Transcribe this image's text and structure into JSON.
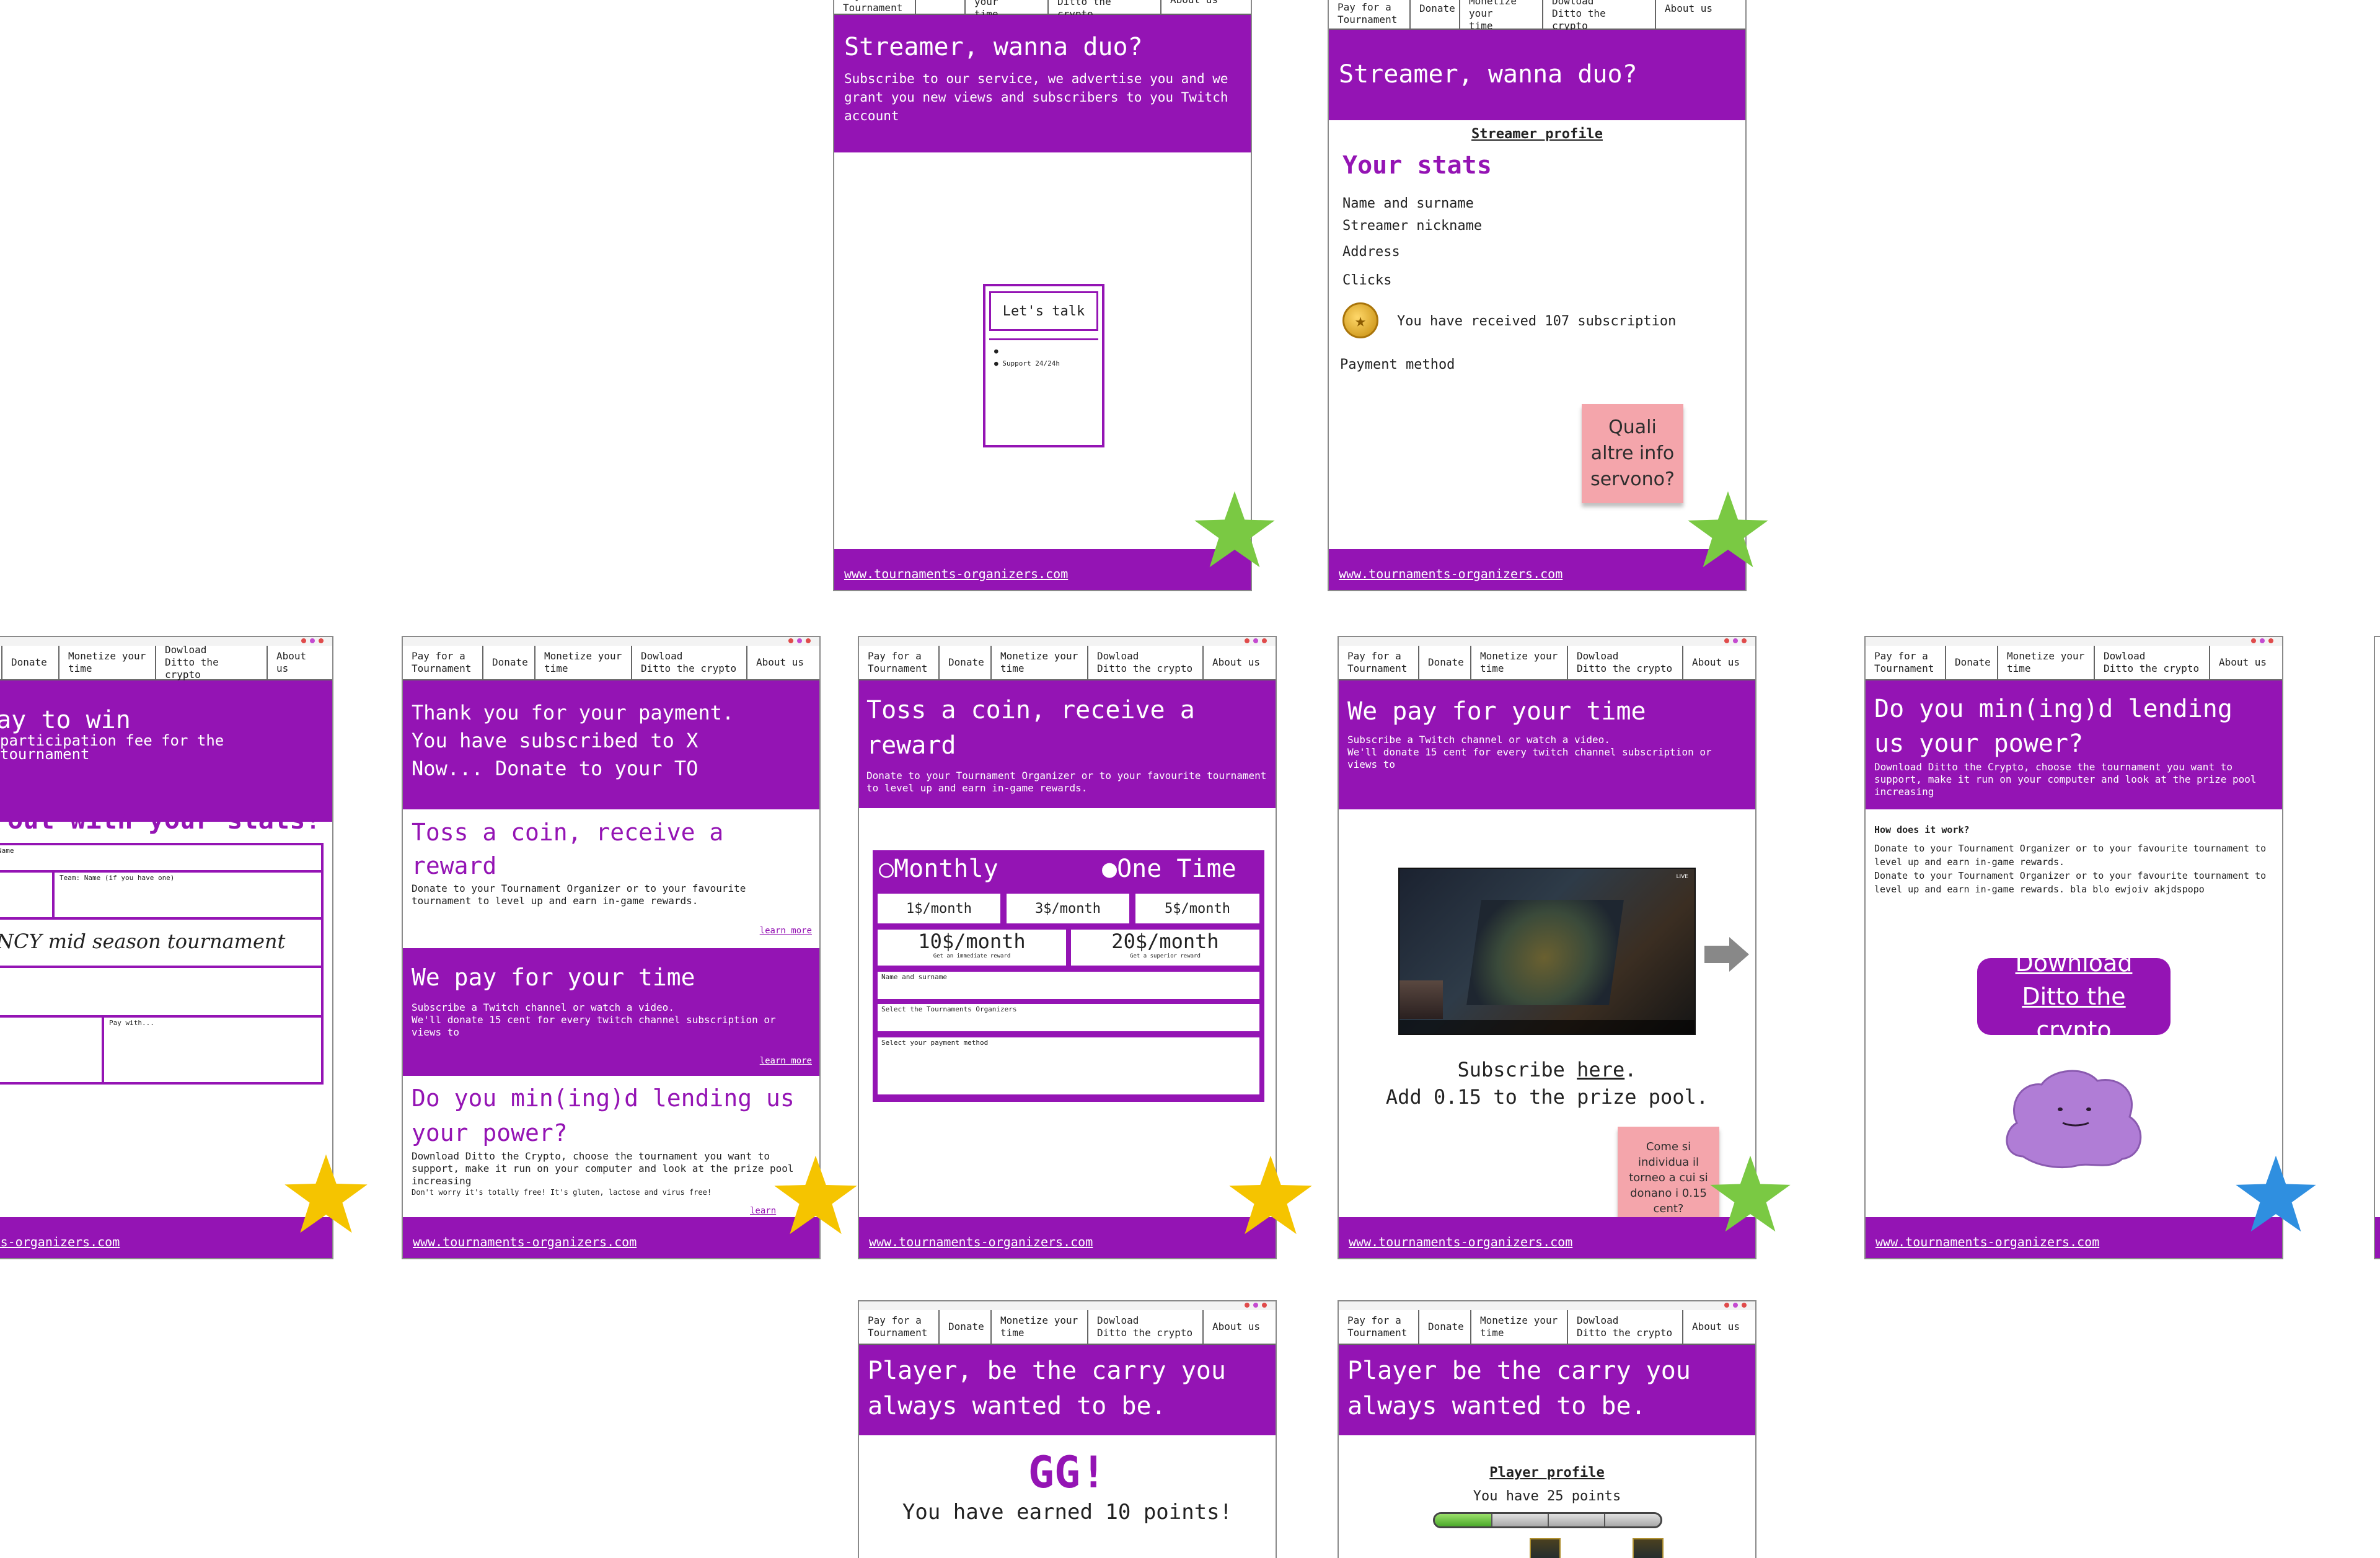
{
  "nav": {
    "pay": "Pay for a\nTournament",
    "donate": "Donate",
    "monetize": "Monetize your\ntime",
    "download": "Dowload\nDitto the crypto",
    "about": "About us"
  },
  "footer_url": "www.tournaments-organizers.com",
  "frame_streamer_duo": {
    "title": "Streamer, wanna duo?",
    "body": "Subscribe to our service, we advertise you and we grant you new views and subscribers to you Twitch account",
    "talk_label": "Let's talk",
    "bullet_empty": "",
    "bullet_support": "Support 24/24h"
  },
  "frame_streamer_profile": {
    "title": "Streamer, wanna duo?",
    "profile_link": "Streamer profile",
    "stats_heading": "Your stats",
    "fields": [
      "Name and surname",
      "Streamer nickname",
      "Address",
      "Clicks"
    ],
    "subscription_text": "You have received 107 subscription",
    "payment_method": "Payment method",
    "sticky_note": "Quali altre info servono?"
  },
  "frame_pay_to_win": {
    "title": "Pay to win",
    "body": "participation fee for the tournament",
    "stats_heading": "out with your stats!",
    "field_name": "Name",
    "field_team": "Team: Name (if you have one)",
    "tournament_name": "NCY mid season tournament",
    "pay_with": "Pay with..."
  },
  "frame_thank_you": {
    "title": "Thank you for your payment.\nYou have subscribed to X\nNow... Donate to your TO",
    "section1_title": "Toss a coin, receive a reward",
    "section1_body": "Donate to your Tournament Organizer or to your favourite tournament to level up and earn in-game rewards.",
    "learn_more": "learn more",
    "section2_title": "We pay for your time",
    "section2_body": "Subscribe a Twitch channel or watch a video.\nWe'll donate 15 cent for every twitch channel subscription or views to",
    "section3_title": "Do you min(ing)d lending us your power?",
    "section3_body": "Download Ditto the Crypto, choose the tournament you want to support, make it run on your computer and look at the prize pool increasing",
    "section3_note": "Don't worry it's totally free! It's gluten, lactose and virus free!",
    "learn_more_cut": "learn"
  },
  "frame_toss_coin": {
    "title": "Toss a coin, receive a reward",
    "body": "Donate to your Tournament Organizer or to your favourite tournament to level up and earn in-game rewards.",
    "monthly": "Monthly",
    "one_time": "One Time",
    "tiers": [
      "1$/month",
      "3$/month",
      "5$/month"
    ],
    "big_tiers": [
      {
        "label": "10$/month",
        "sub": "Get an immediate reward"
      },
      {
        "label": "20$/month",
        "sub": "Get a superior reward"
      }
    ],
    "field_name": "Name and surname",
    "field_to": "Select the Tournaments Organizers",
    "field_payment": "Select your payment method"
  },
  "frame_we_pay": {
    "title": "We pay for your time",
    "body": "Subscribe a Twitch channel or watch a video.\nWe'll donate 15 cent for every twitch channel subscription or views to",
    "live_badge": "LIVE",
    "subscribe_prefix": "Subscribe ",
    "subscribe_link": "here",
    "subscribe_suffix": ".",
    "prize_line": "Add 0.15 to the prize pool.",
    "sticky_note": "Come si individua il torneo a cui si donano i 0.15 cent?"
  },
  "frame_ditto": {
    "title": "Do you min(ing)d lending us your power?",
    "body": "Download Ditto the Crypto, choose the tournament you want to support, make it run on your computer and look at the prize pool increasing",
    "how_heading": "How does it work?",
    "how_body": "Donate to your Tournament Organizer or to your favourite tournament to level up and earn in-game rewards.\nDonate to your Tournament Organizer or to your favourite tournament to level up and earn in-game rewards. bla blo ewjoiv akjdspopo",
    "download_button": "Download Ditto the crypto"
  },
  "frame_gg": {
    "title": "Player, be the carry you always wanted to be.",
    "gg": "GG!",
    "earned": "You have earned 10 points!"
  },
  "frame_player_profile": {
    "title": "Player be the carry you always wanted to be.",
    "profile_link": "Player profile",
    "points_text": "You have 25 points",
    "progress_fraction": 0.25
  },
  "colors": {
    "purple": "#9414b4",
    "star_green": "#7ac943",
    "star_yellow": "#f5c400",
    "star_blue": "#2f8fe0",
    "sticky_pink": "#f4a5ab"
  }
}
